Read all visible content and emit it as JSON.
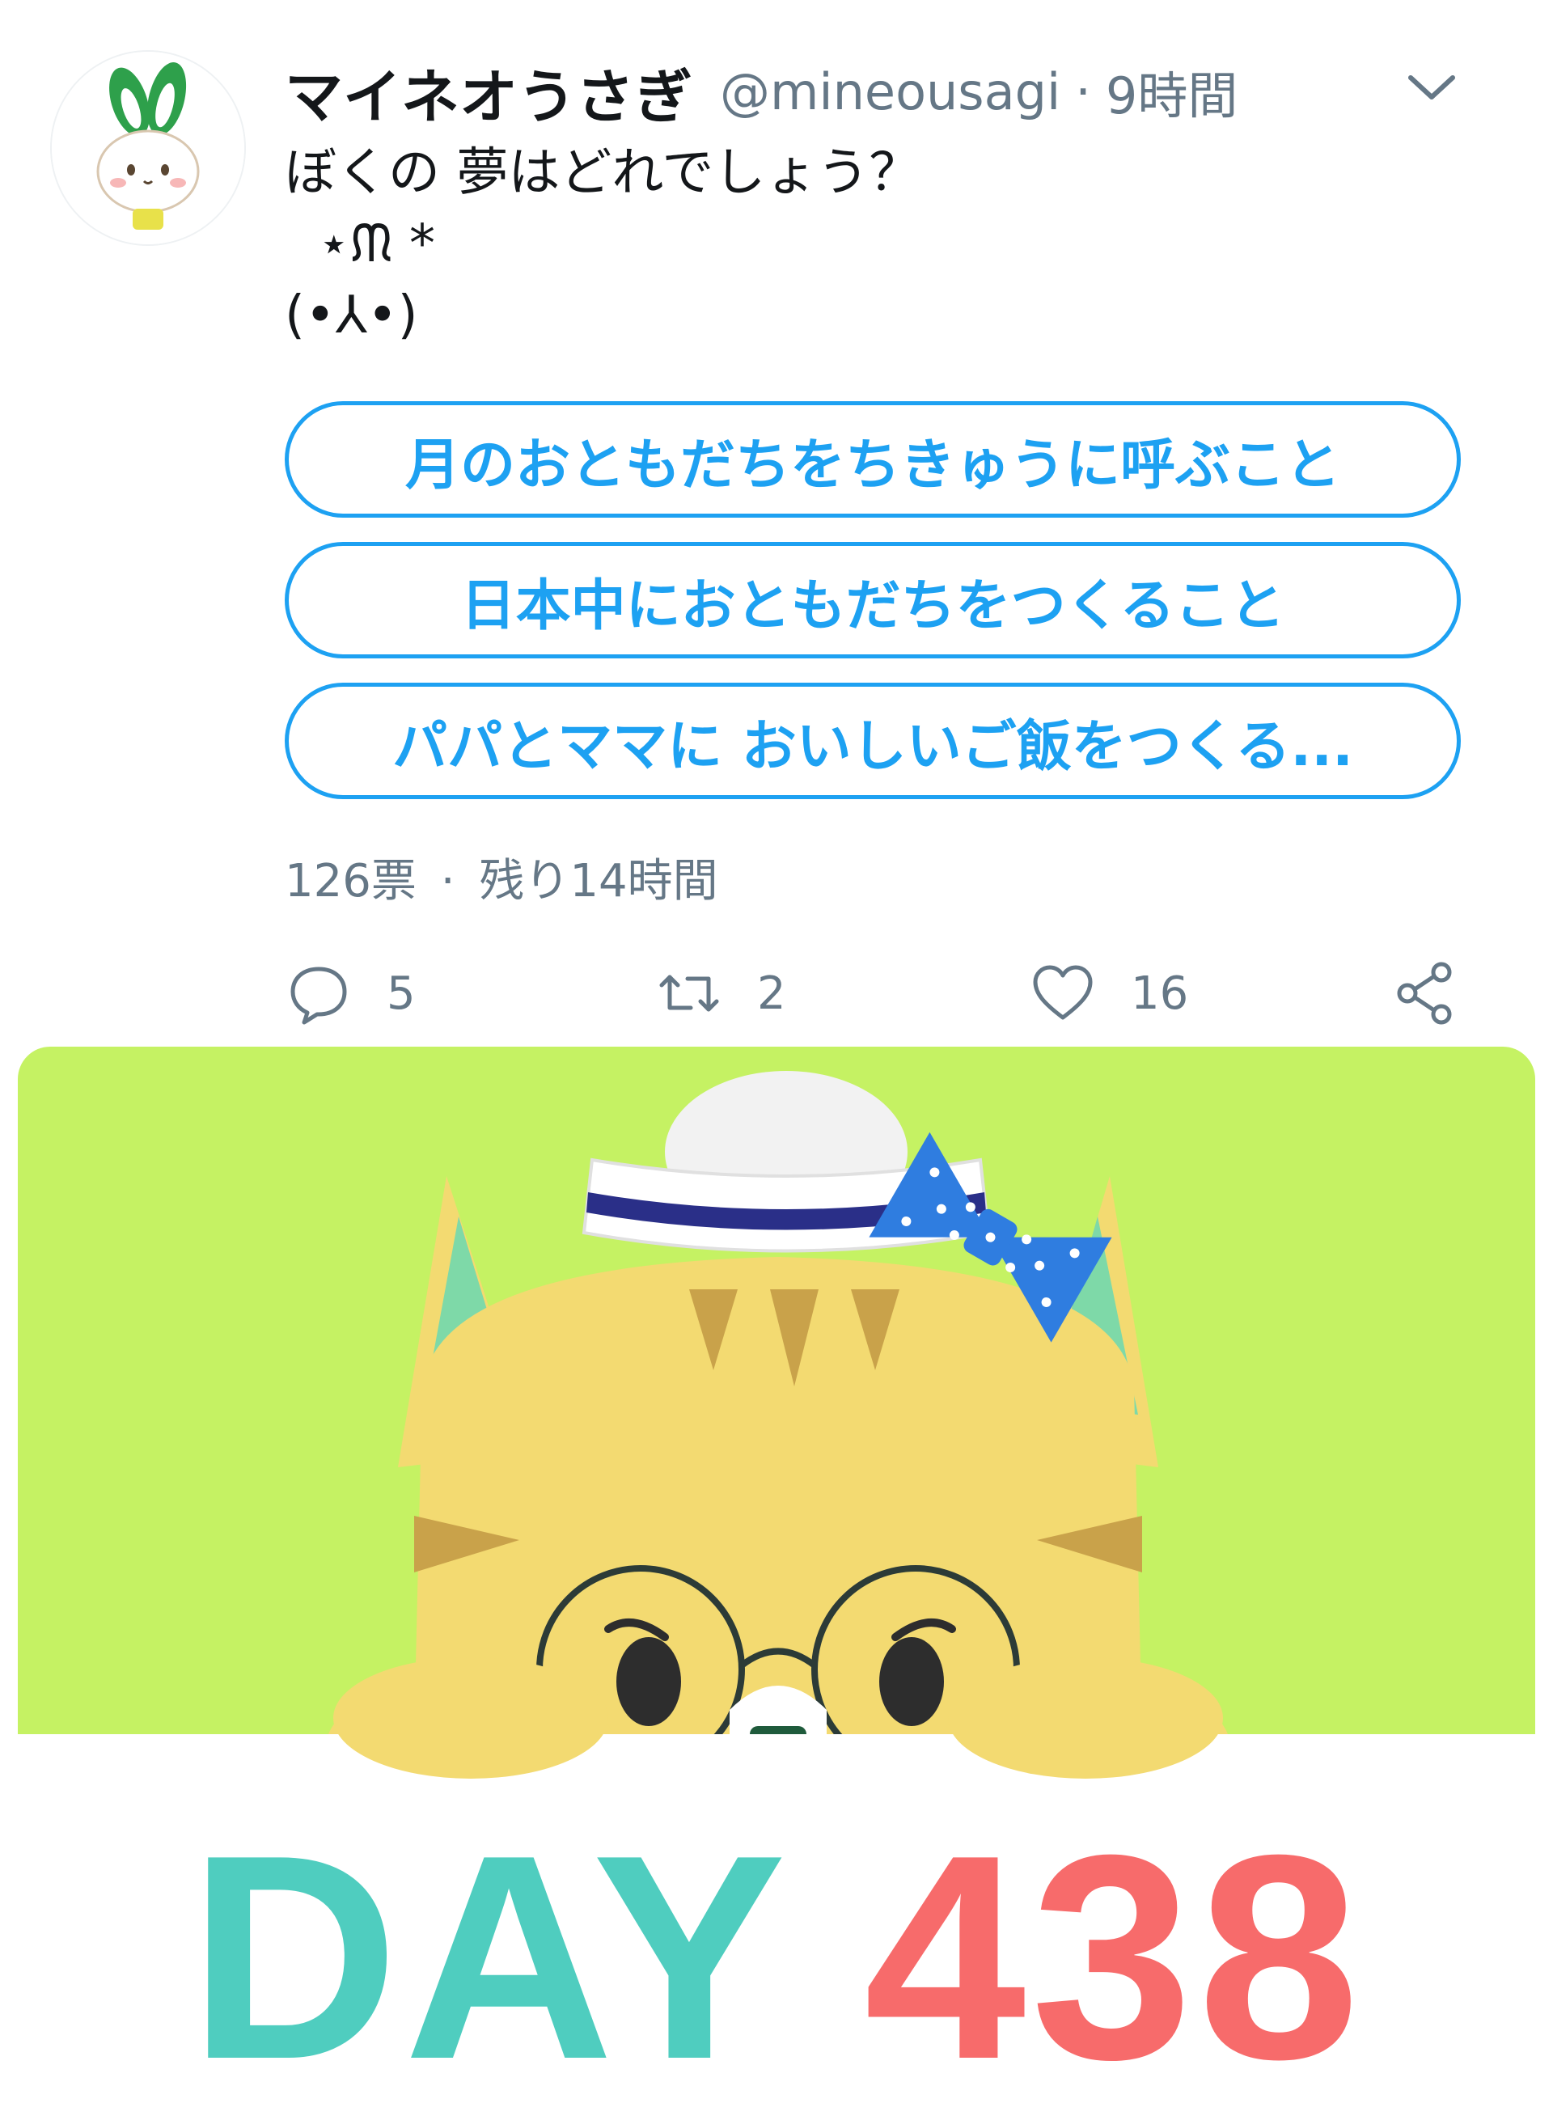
{
  "tweet": {
    "display_name": "マイネオうさぎ",
    "handle": "@mineousagi",
    "separator": "·",
    "time": "9時間",
    "text_lines": [
      "ぼくの 夢はどれでしょう？",
      "  ⋆ᙏ *",
      "(•⅄•)"
    ]
  },
  "poll": {
    "options": [
      "月のおともだちをちきゅうに呼ぶこと",
      "日本中におともだちをつくること",
      "パパとママに おいしいご飯をつくる..."
    ],
    "votes": "126票",
    "separator": "·",
    "remaining": "残り14時間"
  },
  "actions": {
    "reply_count": "5",
    "retweet_count": "2",
    "like_count": "16"
  },
  "media": {
    "day_word": "DAY",
    "day_number": "438"
  },
  "icons": {
    "more": "chevron-down-icon",
    "reply": "reply-icon",
    "retweet": "retweet-icon",
    "like": "heart-icon",
    "share": "share-icon"
  },
  "colors": {
    "accent": "#1da1f2",
    "meta": "#657786",
    "media_bg": "#c5f263",
    "day_word": "#4fcdbf",
    "day_number": "#f76b6b"
  }
}
